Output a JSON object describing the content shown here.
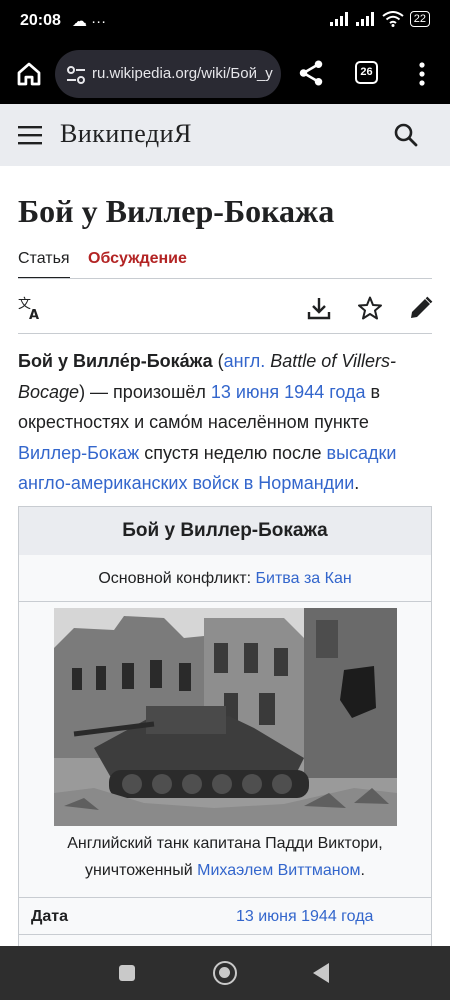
{
  "status_bar": {
    "time": "20:08",
    "left_icons": "☁ ···",
    "battery": "22"
  },
  "browser": {
    "url": "ru.wikipedia.org/wiki/Бой_у",
    "tab_count": "26"
  },
  "wiki": {
    "wordmark": "ВикипедиЯ"
  },
  "page": {
    "title": "Бой у Виллер-Бокажа",
    "tabs": {
      "article": "Статья",
      "talk": "Обсуждение"
    },
    "lead": {
      "term": "Бой у Вилле́р-Бока́жа",
      "open_paren": " (",
      "lang_link": "англ.",
      "english_title": " Battle of Villers-Bocage",
      "happened": ") — произошёл ",
      "date_link": "13 июня 1944 года",
      "near": " в окрестностях и само́м населённом пункте ",
      "place_link": "Виллер-Бокаж",
      "after": " спустя неделю после ",
      "landing_link": "высадки англо-американских войск в Нормандии",
      "end": "."
    }
  },
  "infobox": {
    "title": "Бой у Виллер-Бокажа",
    "conflict_label": "Основной конфликт: ",
    "conflict_link": "Битва за Кан",
    "caption_text": "Английский танк капитана Падди Виктори, уничтоженный ",
    "caption_link": "Михаэлем Виттманом",
    "caption_end": ".",
    "date_label": "Дата",
    "date_value": "13 июня 1944 года"
  },
  "icons": {
    "home": "home-icon",
    "site_settings": "tune-icon",
    "share": "share-icon",
    "menu": "more-vert-icon",
    "hamburger": "hamburger-icon",
    "search": "search-icon",
    "language": "translate-icon",
    "download": "download-icon",
    "watch": "star-icon",
    "edit": "pencil-icon"
  },
  "colors": {
    "link": "#3366cc",
    "talk_tab": "#b32424",
    "header_bg": "#eaecf0",
    "infobox_bg": "#f8f9fa"
  }
}
